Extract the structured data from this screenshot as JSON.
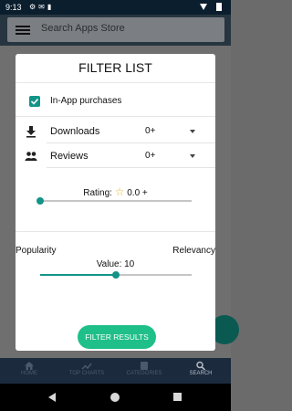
{
  "status_bar": {
    "time": "9:13",
    "icons": [
      "settings-icon",
      "gmail-icon",
      "sd-card-icon",
      "wifi-icon",
      "battery-icon"
    ]
  },
  "app_bar": {
    "search_placeholder": "Search Apps Store",
    "menu_icon": "hamburger-menu-icon"
  },
  "dialog": {
    "title": "FILTER LIST",
    "in_app_purchases": {
      "label": "In-App purchases",
      "checked": true
    },
    "rows": [
      {
        "icon": "download-icon",
        "label": "Downloads",
        "value": "0+"
      },
      {
        "icon": "people-icon",
        "label": "Reviews",
        "value": "0+"
      }
    ],
    "rating": {
      "prefix": "Rating:",
      "value": "0.0 +",
      "level": 0
    },
    "sort": {
      "left": "Popularity",
      "right": "Relevancy"
    },
    "value": {
      "text": "Value: 10",
      "level": 0.5
    },
    "apply_button": "FILTER RESULTS"
  },
  "bottom_nav": {
    "items": [
      {
        "label": "HOME",
        "icon": "home-icon"
      },
      {
        "label": "TOP CHARTS",
        "icon": "trending-icon"
      },
      {
        "label": "CATEGORIES",
        "icon": "categories-icon"
      },
      {
        "label": "SEARCH",
        "icon": "search-icon",
        "active": true
      }
    ]
  },
  "colors": {
    "accent": "#129488",
    "button": "#1fbf8a",
    "star": "#e5b62f"
  }
}
